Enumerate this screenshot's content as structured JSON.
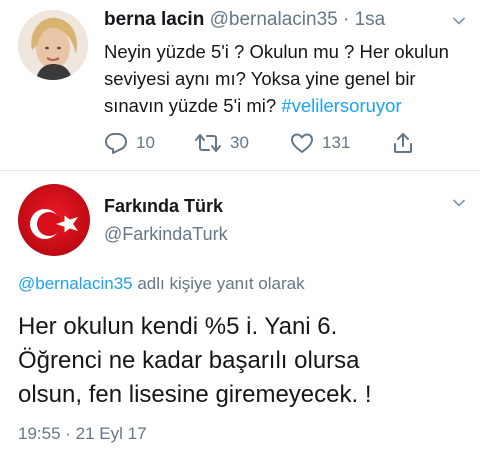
{
  "tweet1": {
    "author_name": "berna lacin",
    "author_handle": "@bernalacin35",
    "separator": "·",
    "time": "1sa",
    "body_text": "Neyin yüzde 5'i ? Okulun mu ? Her okulun seviyesi aynı mı? Yoksa yine genel bir sınavın  yüzde 5'i mi? ",
    "hashtag": "#velilersoruyor",
    "reply_count": "10",
    "retweet_count": "30",
    "like_count": "131"
  },
  "tweet2": {
    "author_name": "Farkında Türk",
    "author_handle": "@FarkindaTurk",
    "reply_to_mention": "@bernalacin35",
    "reply_to_suffix": " adlı kişiye yanıt olarak",
    "body_lines": [
      "Her okulun kendi %5 i.  Yani 6.",
      "Öğrenci ne kadar başarılı olursa",
      "olsun, fen lisesine giremeyecek. !"
    ],
    "timestamp": "19:55 · 21 Eyl 17"
  },
  "colors": {
    "text_primary": "#14171a",
    "text_secondary": "#657786",
    "link": "#1da1f2",
    "divider": "#e1e8ed",
    "flag_red": "#e30a17"
  },
  "icons": {
    "reply": "reply-icon",
    "retweet": "retweet-icon",
    "like": "heart-icon",
    "share": "share-icon",
    "menu": "chevron-down-icon"
  }
}
